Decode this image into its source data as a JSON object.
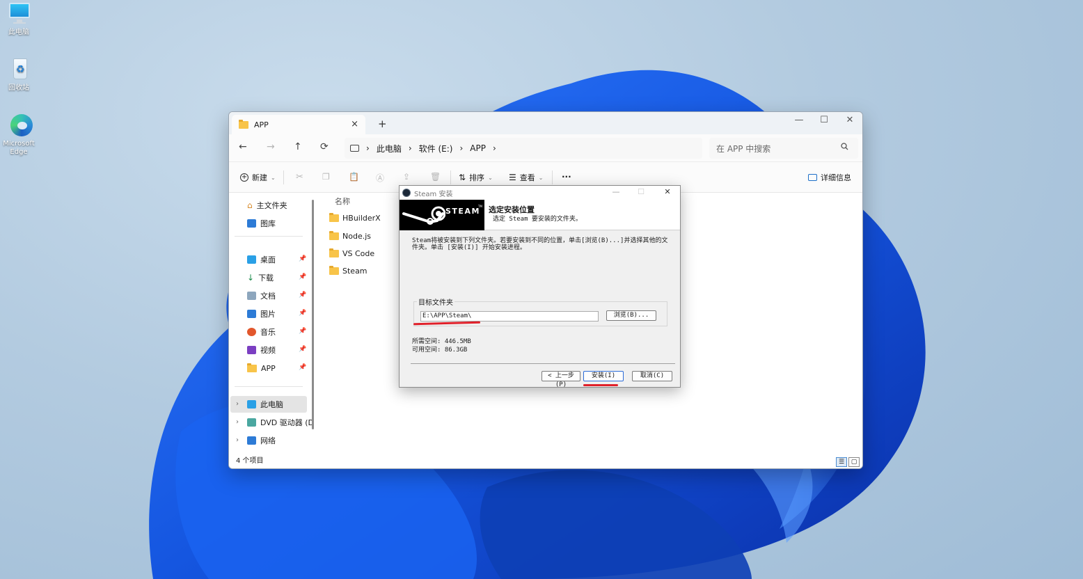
{
  "desktop": {
    "icons": [
      {
        "label": "此电脑",
        "icon": "monitor-icon"
      },
      {
        "label": "回收站",
        "icon": "recycle-bin-icon"
      },
      {
        "label": "Microsoft Edge",
        "icon": "edge-icon"
      }
    ]
  },
  "explorer": {
    "tab_title": "APP",
    "tab_close": "×",
    "new_tab": "+",
    "window_controls": {
      "minimize": "—",
      "maximize": "☐",
      "close": "✕"
    },
    "nav": {
      "back": "←",
      "forward": "→",
      "up": "↑",
      "refresh": "⟳"
    },
    "breadcrumb": [
      "此电脑",
      "软件 (E:)",
      "APP"
    ],
    "breadcrumb_sep": "›",
    "search_placeholder": "在 APP 中搜索",
    "toolbar": {
      "new_label": "新建",
      "sort_label": "排序",
      "view_label": "查看",
      "more_label": "···",
      "details_label": "详细信息"
    },
    "sidebar": {
      "quick": [
        "主文件夹",
        "图库"
      ],
      "pinned": [
        "桌面",
        "下载",
        "文档",
        "图片",
        "音乐",
        "视频",
        "APP"
      ],
      "tree": [
        "此电脑",
        "DVD 驱动器 (D",
        "网络"
      ]
    },
    "column_header": "名称",
    "files": [
      "HBuilderX",
      "Node.js",
      "VS Code",
      "Steam"
    ],
    "status": "4 个项目"
  },
  "installer": {
    "title": "Steam 安装",
    "logo_text": "STEAM",
    "logo_tm": "TM",
    "header_title": "选定安装位置",
    "header_sub": "选定 Steam 要安装的文件夹。",
    "description": "Steam将被安装到下列文件夹。若要安装到不同的位置，单击[浏览(B)...]并选择其他的文件夹。单击 [安装(I)] 开始安装进程。",
    "group_label": "目标文件夹",
    "path_value": "E:\\APP\\Steam\\",
    "browse_label": "浏览(B)...",
    "space_required": "所需空间: 446.5MB",
    "space_available": "可用空间: 86.3GB",
    "back_label": "< 上一步(P)",
    "install_label": "安装(I)",
    "cancel_label": "取消(C)"
  },
  "colors": {
    "annotation_red": "#e0202a",
    "folder_yellow": "#f8c449",
    "steam_black": "#000000"
  }
}
